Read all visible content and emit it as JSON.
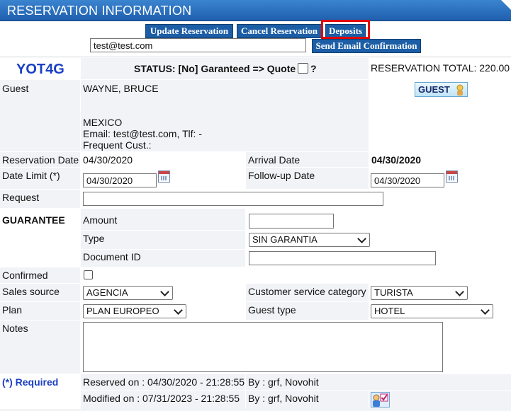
{
  "header": {
    "title": "RESERVATION INFORMATION"
  },
  "toolbar": {
    "update_label": "Update Reservation",
    "cancel_label": "Cancel Reservation",
    "deposits_label": "Deposits",
    "email_value": "test@test.com",
    "send_email_label": "Send Email Confirmation"
  },
  "summary": {
    "code": "YOT4G",
    "status": "STATUS: [No] Garanteed => Quote",
    "status_q": "?",
    "total": "RESERVATION TOTAL: 220.00"
  },
  "guest": {
    "label": "Guest",
    "name": "WAYNE, BRUCE",
    "country": "MEXICO",
    "contact": "Email: test@test.com, Tlf: -",
    "frequent": "Frequent Cust.:",
    "button": "GUEST"
  },
  "dates": {
    "reservation_label": "Reservation Date",
    "reservation_value": "04/30/2020",
    "arrival_label": "Arrival Date",
    "arrival_value": "04/30/2020",
    "limit_label": "Date Limit (*)",
    "limit_value": "04/30/2020",
    "followup_label": "Follow-up Date",
    "followup_value": "04/30/2020"
  },
  "request": {
    "label": "Request",
    "value": ""
  },
  "guarantee": {
    "label": "GUARANTEE",
    "amount_label": "Amount",
    "amount_value": "",
    "type_label": "Type",
    "type_value": "SIN GARANTIA",
    "doc_label": "Document ID",
    "doc_value": ""
  },
  "confirmed": {
    "label": "Confirmed",
    "checked": false
  },
  "sales": {
    "source_label": "Sales source",
    "source_value": "AGENCIA",
    "category_label": "Customer service category",
    "category_value": "TURISTA"
  },
  "plan": {
    "label": "Plan",
    "value": "PLAN EUROPEO",
    "guest_type_label": "Guest type",
    "guest_type_value": "HOTEL"
  },
  "notes": {
    "label": "Notes",
    "value": ""
  },
  "footer": {
    "required": "(*) Required",
    "reserved": "Reserved on : 04/30/2020 - 21:28:55",
    "reserved_by": "By : grf, Novohit",
    "modified": "Modified on : 07/31/2023 - 21:28:55",
    "modified_by": "By : grf, Novohit"
  },
  "colors": {
    "accent": "#1c5ea6",
    "header": "#2a6fc0",
    "highlight": "#e10000",
    "code": "#1a3fc4"
  },
  "icons": [
    "calendar-icon",
    "guest-icon",
    "edit-user-icon"
  ]
}
